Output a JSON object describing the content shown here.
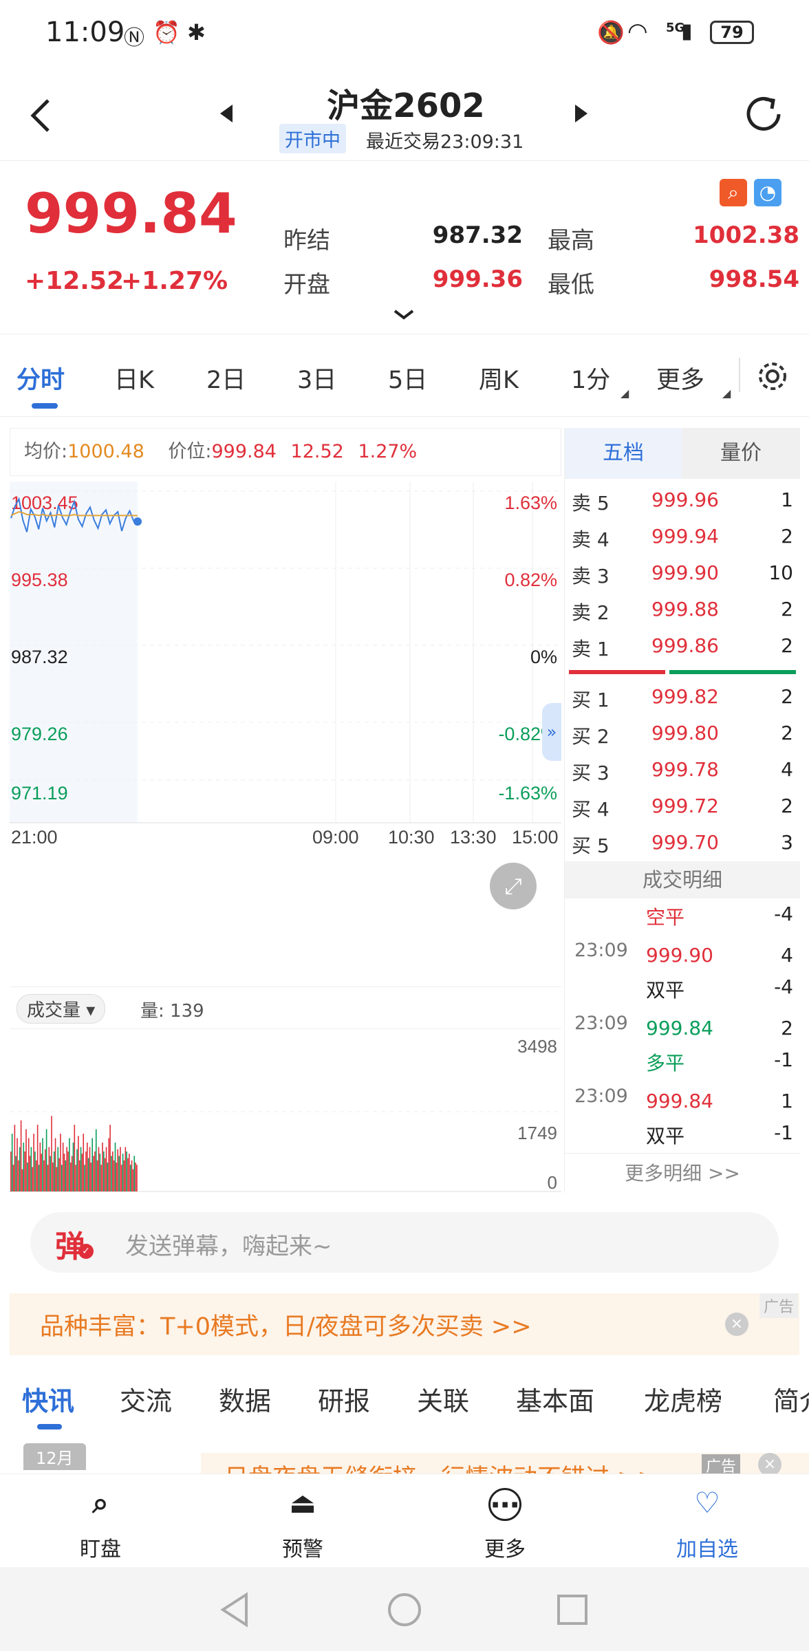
{
  "status_bar": {
    "time": "11:09",
    "network": "5G",
    "battery": "79"
  },
  "header": {
    "title": "沪金2602",
    "market_status": "开市中",
    "last_trade": "最近交易23:09:31"
  },
  "quote": {
    "price": "999.84",
    "change": "+12.52",
    "change_pct": "+1.27%",
    "stats": [
      {
        "label": "昨结",
        "value": "987.32",
        "color": "#222222"
      },
      {
        "label": "最高",
        "value": "1002.38",
        "color": "#e02f3a"
      },
      {
        "label": "开盘",
        "value": "999.36",
        "color": "#e02f3a"
      },
      {
        "label": "最低",
        "value": "998.54",
        "color": "#e02f3a"
      }
    ]
  },
  "tabs": [
    "分时",
    "日K",
    "2日",
    "3日",
    "5日",
    "周K",
    "1分",
    "更多"
  ],
  "active_tab": "分时",
  "chart_info": {
    "avg_label": "均价:",
    "avg_value": "1000.48",
    "pos_label": "价位:",
    "pos_value": "999.84",
    "chg": "12.52",
    "pct": "1.27%"
  },
  "chart_data": {
    "type": "line",
    "y_ticks": [
      "1003.45",
      "995.38",
      "987.32",
      "979.26",
      "971.19"
    ],
    "y_pct_ticks": [
      "1.63%",
      "0.82%",
      "0%",
      "-0.82%",
      "-1.63%"
    ],
    "x_ticks": [
      "21:00",
      "09:00",
      "10:30",
      "13:30",
      "15:00"
    ],
    "series": [
      {
        "values": [
          1000.2,
          1001.5,
          1002.3,
          1000.0,
          998.7,
          1001.2,
          1000.4,
          999.0,
          1001.3,
          999.9,
          1000.8,
          999.2,
          1001.6,
          1000.3,
          999.5,
          1000.9,
          1002.0,
          1000.1,
          999.3,
          1000.7,
          1001.4,
          1000.0,
          999.1,
          1000.6,
          1001.1,
          999.6,
          1000.5,
          1000.9,
          998.8,
          1000.2,
          1001.0,
          999.9,
          999.84
        ]
      },
      {
        "values": [
          1000.5,
          1000.7,
          1000.9,
          1000.8,
          1000.6,
          1000.6,
          1000.6,
          1000.5,
          1000.6,
          1000.5,
          1000.5,
          1000.5,
          1000.6,
          1000.5,
          1000.5,
          1000.5,
          1000.6,
          1000.5,
          1000.5,
          1000.5,
          1000.5,
          1000.5,
          1000.5,
          1000.5,
          1000.5,
          1000.5,
          1000.5,
          1000.5,
          1000.5,
          1000.5,
          1000.5,
          1000.5,
          1000.48
        ]
      }
    ],
    "ylim": [
      971.19,
      1003.45
    ]
  },
  "volume": {
    "label": "成交量",
    "qty_label": "量: 139",
    "ticks": [
      "3498",
      "1749",
      "0"
    ],
    "bars": [
      900,
      1300,
      600,
      1500,
      800,
      1200,
      700,
      1000,
      1600,
      500,
      1100,
      900,
      1400,
      650,
      1200,
      800,
      1000,
      550,
      1300,
      900,
      700,
      1500,
      600,
      1100,
      850,
      1200,
      700,
      950,
      1400,
      600,
      1000,
      800,
      1700,
      650,
      900,
      1200,
      550,
      1000,
      750,
      1300,
      600,
      1100,
      850,
      700,
      1000,
      900,
      1200,
      650,
      800,
      1100,
      1500,
      600,
      950,
      1250,
      700,
      1000,
      850,
      1300,
      600,
      900,
      1100,
      750,
      1000,
      650,
      1200,
      800,
      900,
      1400,
      700,
      1000,
      850,
      600,
      1100,
      900,
      750,
      1000,
      650,
      1200,
      1500,
      800,
      900,
      700,
      1100,
      650,
      950,
      800,
      1000,
      600,
      850,
      700,
      1000,
      900,
      750,
      850,
      600,
      700,
      500,
      800,
      650,
      600
    ]
  },
  "depth": {
    "tabs": [
      "五档",
      "量价"
    ],
    "asks": [
      {
        "label": "卖 5",
        "price": "999.96",
        "vol": "1"
      },
      {
        "label": "卖 4",
        "price": "999.94",
        "vol": "2"
      },
      {
        "label": "卖 3",
        "price": "999.90",
        "vol": "10"
      },
      {
        "label": "卖 2",
        "price": "999.88",
        "vol": "2"
      },
      {
        "label": "卖 1",
        "price": "999.86",
        "vol": "2"
      }
    ],
    "bids": [
      {
        "label": "买 1",
        "price": "999.82",
        "vol": "2"
      },
      {
        "label": "买 2",
        "price": "999.80",
        "vol": "2"
      },
      {
        "label": "买 3",
        "price": "999.78",
        "vol": "4"
      },
      {
        "label": "买 4",
        "price": "999.72",
        "vol": "2"
      },
      {
        "label": "买 5",
        "price": "999.70",
        "vol": "3"
      }
    ]
  },
  "trades": {
    "title": "成交明细",
    "rows": [
      {
        "time": "",
        "price": "空平",
        "vol": "-4",
        "pcolor": "#e02f3a"
      },
      {
        "time": "23:09",
        "price": "999.90",
        "vol": "4",
        "pcolor": "#e02f3a"
      },
      {
        "time": "",
        "price": "双平",
        "vol": "-4",
        "pcolor": "#222222"
      },
      {
        "time": "23:09",
        "price": "999.84",
        "vol": "2",
        "pcolor": "#0a9e5a"
      },
      {
        "time": "",
        "price": "多平",
        "vol": "-1",
        "pcolor": "#0a9e5a"
      },
      {
        "time": "23:09",
        "price": "999.84",
        "vol": "1",
        "pcolor": "#e02f3a"
      },
      {
        "time": "",
        "price": "双平",
        "vol": "-1",
        "pcolor": "#222222"
      }
    ],
    "more": "更多明细 >>"
  },
  "danmu": {
    "icon": "弹",
    "placeholder": "发送弹幕，嗨起来~"
  },
  "ad": {
    "text": "品种丰富：T+0模式，日/夜盘可多次买卖 >>",
    "tag": "广告"
  },
  "news_tabs": [
    "快讯",
    "交流",
    "数据",
    "研报",
    "关联",
    "基本面",
    "龙虎榜",
    "简介"
  ],
  "news_active": "快讯",
  "news": {
    "month": "12月",
    "banner": "日盘夜盘无缝衔接，行情波动不错过 >>",
    "banner_tag": "广告"
  },
  "bottom_nav": [
    {
      "icon": "watch-icon",
      "label": "盯盘",
      "color": "#222222"
    },
    {
      "icon": "alarm-icon",
      "label": "预警",
      "color": "#222222"
    },
    {
      "icon": "more-icon",
      "label": "更多",
      "color": "#222222"
    },
    {
      "icon": "heart-plus-icon",
      "label": "加自选",
      "color": "#2e6fd8"
    }
  ]
}
